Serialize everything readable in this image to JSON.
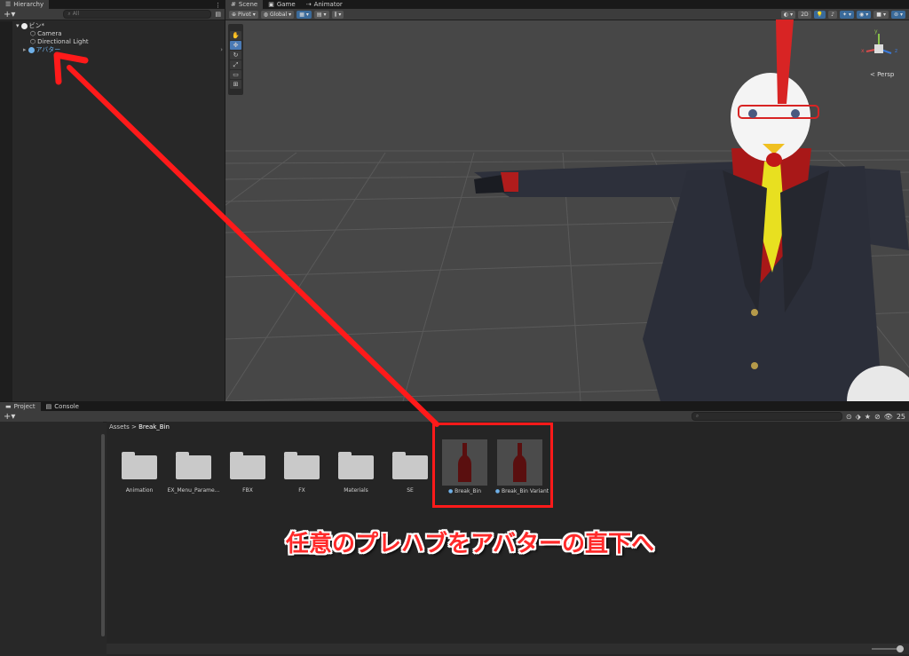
{
  "hierarchy": {
    "tab_label": "Hierarchy",
    "search_placeholder": "All",
    "scene_name": "ビン*",
    "items": [
      "Camera",
      "Directional Light",
      "アバター"
    ]
  },
  "scene": {
    "tabs": [
      "Scene",
      "Game",
      "Animator"
    ],
    "pivot_label": "Pivot",
    "global_label": "Global",
    "mode_2d": "2D",
    "persp_label": "< Persp",
    "gizmo_axes": [
      "y",
      "x",
      "z"
    ]
  },
  "project": {
    "tabs": [
      "Project",
      "Console"
    ],
    "breadcrumb_root": "Assets",
    "breadcrumb_sep": ">",
    "breadcrumb_current": "Break_Bin",
    "visibility_count": "25",
    "folders": [
      "Animation",
      "EX_Menu_Parame...",
      "FBX",
      "FX",
      "Materials",
      "SE"
    ],
    "prefabs": [
      "Break_Bin",
      "Break_Bin Variant"
    ]
  },
  "annotation": {
    "caption": "任意のプレハブをアバターの直下へ",
    "color": "#ff1a1a"
  },
  "colors": {
    "panel": "#282828",
    "scene_bg": "#474747",
    "selection": "#4a7ab5",
    "prefab_blue": "#6fb0e8"
  }
}
